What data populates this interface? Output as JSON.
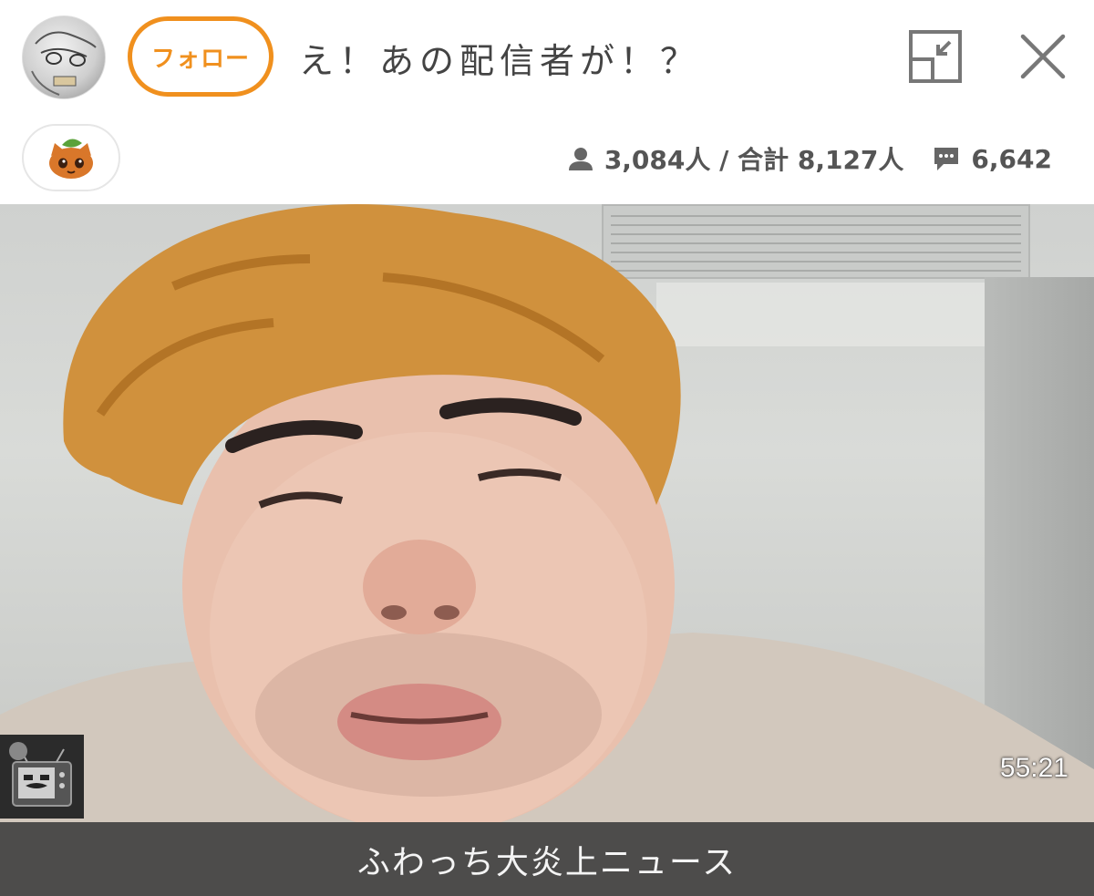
{
  "header": {
    "follow_label": "フォロー",
    "title": "え！あの配信者が！？"
  },
  "stats": {
    "viewers_text": "3,084人 / 合計 8,127人",
    "comments_text": "6,642"
  },
  "video": {
    "timer": "55:21"
  },
  "caption": {
    "text": "ふわっち大炎上ニュース"
  },
  "icons": {
    "avatar": "broadcaster-avatar",
    "pip": "minimize-window-icon",
    "close": "close-icon",
    "badge": "cat-leaf-badge-icon",
    "viewers": "person-icon",
    "comments": "comment-icon"
  },
  "colors": {
    "accent": "#f0901e",
    "caption_bg": "#4d4c4b",
    "text": "#444444"
  }
}
